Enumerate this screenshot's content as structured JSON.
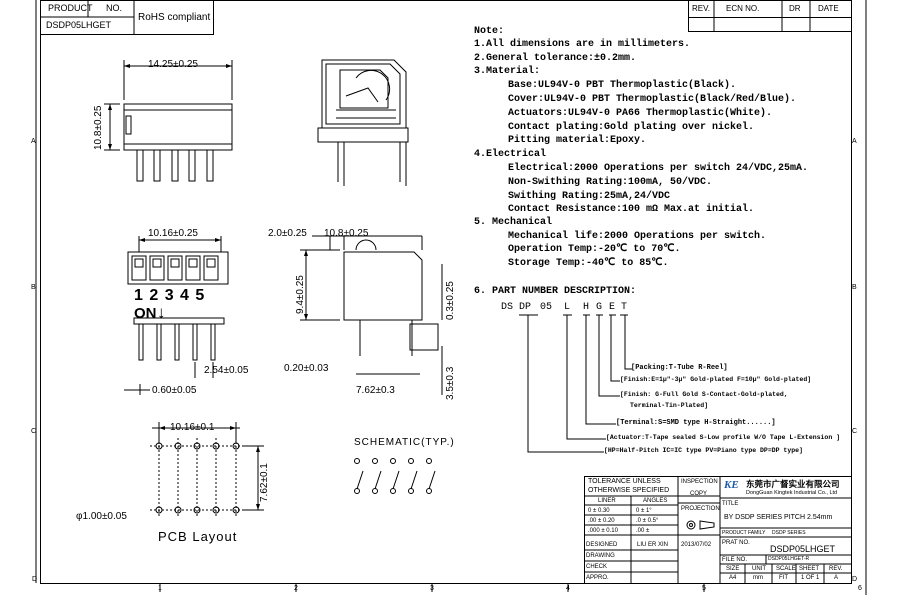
{
  "header": {
    "product_label": "PRODUCT",
    "no_label": "NO.",
    "part_number": "DSDP05LHGET",
    "rohs": "RoHS compliant"
  },
  "revision_block": {
    "rev": "REV.",
    "ecn_no": "ECN NO.",
    "dr": "DR",
    "date": "DATE"
  },
  "zones": {
    "rows": [
      "A",
      "B",
      "C",
      "D"
    ],
    "cols": [
      "1",
      "2",
      "3",
      "4",
      "5",
      "6"
    ]
  },
  "views": {
    "front_width": "14.25±0.25",
    "front_height": "10.8±0.25",
    "top_pitch": "10.16±0.25",
    "switch_numbers": "1 2 3 4 5",
    "on_label": "ON",
    "on_arrow": "↓",
    "pin_pitch": "2.54±0.05",
    "pin_thickness": "0.60±0.05",
    "side_offset": "2.0±0.25",
    "side_width": "10.8±0.25",
    "side_height": "9.4±0.25",
    "side_small": "0.3±0.25",
    "side_gap": "0.20±0.03",
    "side_pins": "7.62±0.3",
    "side_pin_len": "3.5±0.3",
    "pcb_pitch": "10.16±0.1",
    "pcb_row": "7.62±0.1",
    "pcb_hole": "φ1.00±0.05",
    "pcb_title": "PCB Layout",
    "schematic_title": "SCHEMATIC(TYP.)"
  },
  "notes": {
    "title": "Note:",
    "lines": [
      "1.All dimensions are in millimeters.",
      "2.General tolerance:±0.2mm.",
      "3.Material:",
      "Base:UL94V-0 PBT Thermoplastic(Black).",
      "Cover:UL94V-0 PBT Thermoplastic(Black/Red/Blue).",
      "Actuators:UL94V-0 PA66 Thermoplastic(White).",
      "Contact plating:Gold plating over nickel.",
      "Pitting material:Epoxy.",
      "4.Electrical",
      "Electrical:2000 Operations per switch 24/VDC,25mA.",
      "Non-Swithing Rating:100mA, 50/VDC.",
      "Swithing Rating:25mA,24/VDC",
      "Contact Resistance:100 mΩ Max.at initial.",
      "5. Mechanical",
      "Mechanical life:2000 Operations per switch.",
      "Operation Temp:-20℃ to 70℃.",
      "Storage Temp:-40℃ to 85℃."
    ],
    "pn_title": "6. PART NUMBER DESCRIPTION:",
    "pn_segments": [
      "DS",
      "DP",
      "05",
      "L",
      "H",
      "G",
      "E",
      "T"
    ],
    "pn_annotations": [
      "[Packing:T-Tube R-Reel]",
      "[Finish:E=1μ\"-3μ\" Gold-plated F=10μ\" Gold-plated]",
      "[Finish: G-Full Gold S-Contact-Gold-plated,",
      "Terminal-Tin-Plated]",
      "[Terminal:S=SMD type H-Straight......]",
      "[Actuator:T-Tape sealed S-Low profile W/O Tape L-Extension ]",
      "[HP=Half-Pitch IC=IC type PV=Piano type DP=DP type]"
    ]
  },
  "title_block": {
    "tol_title1": "TOLERANCE UNLESS",
    "tol_title2": "OTHERWISE SPECIFIED",
    "liner": "LINER",
    "angles": "ANGLES",
    "tol_rows": [
      [
        "0  ±  0.30",
        "0  ±  1°"
      ],
      [
        ".00 ±  0.20",
        ".0 ±  0.5°"
      ],
      [
        ".000 ± 0.10",
        ".00 ±"
      ]
    ],
    "inspection": "INSPECTION",
    "copy": "COPY",
    "projection": "PROJECTION",
    "company_cn": "东莞市广督实业有限公司",
    "company_en": "DongGuan Kingtek Industrial Co., Ltd",
    "logo": "KE",
    "title_label": "TITLE",
    "title_value": "BY DSDP SERIES PITCH 2.54mm",
    "family_label": "PRODUCT FAMILY",
    "family_value": "DSDP SERIES",
    "prat_label": "PRAT NO.",
    "prat_value": "DSDP05LHGET",
    "designed": "DESIGNED",
    "drawn": "DRAWING",
    "check": "CHECK",
    "appro": "APPRO.",
    "designer": "LIU ER XIN",
    "date": "2013/07/02",
    "file_label": "FILE NO.",
    "file_value": "DSDP05LHGET-R",
    "size_label": "SIZE",
    "unit_label": "UNIT",
    "scale_label": "SCALE",
    "sheet_label": "SHEET",
    "rev_label": "REV.",
    "size_value": "A4",
    "unit_value": "mm",
    "scale_value": "FIT",
    "sheet_value": "1 OF 1",
    "rev_value": "A"
  }
}
